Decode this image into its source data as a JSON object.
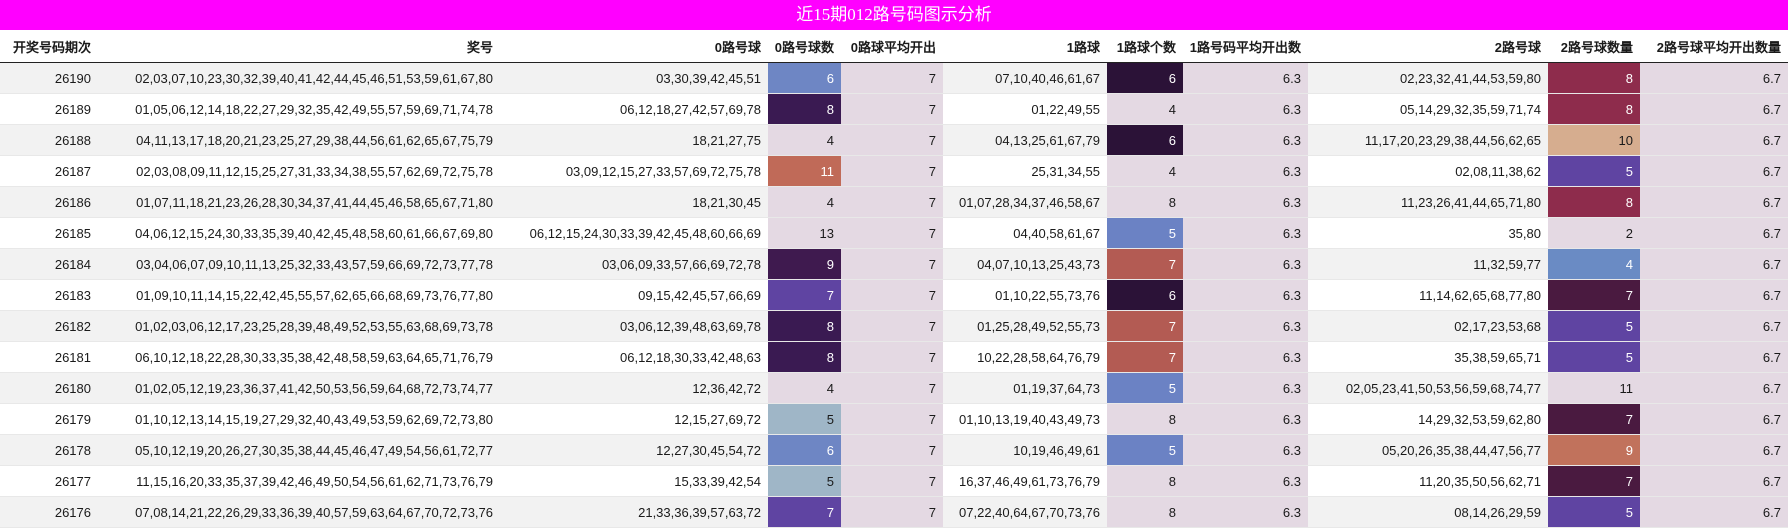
{
  "title": "近15期012路号码图示分析",
  "headers": [
    "开奖号码期次",
    "奖号",
    "0路号球",
    "0路号球数",
    "0路球平均开出",
    "1路球",
    "1路球个数",
    "1路号码平均开出数",
    "2路号球",
    "2路号球数量",
    "2路号球平均开出数量"
  ],
  "rows": [
    {
      "period": "26190",
      "numbers": "02,03,07,10,23,30,32,39,40,41,42,44,45,46,51,53,59,61,67,80",
      "r0": "03,30,39,42,45,51",
      "c0": "6",
      "a0": "7",
      "r1": "07,10,40,46,61,67",
      "c1": "6",
      "a1": "6.3",
      "r2": "02,23,32,41,44,53,59,80",
      "c2": "8",
      "a2": "6.7"
    },
    {
      "period": "26189",
      "numbers": "01,05,06,12,14,18,22,27,29,32,35,42,49,55,57,59,69,71,74,78",
      "r0": "06,12,18,27,42,57,69,78",
      "c0": "8",
      "a0": "7",
      "r1": "01,22,49,55",
      "c1": "4",
      "a1": "6.3",
      "r2": "05,14,29,32,35,59,71,74",
      "c2": "8",
      "a2": "6.7"
    },
    {
      "period": "26188",
      "numbers": "04,11,13,17,18,20,21,23,25,27,29,38,44,56,61,62,65,67,75,79",
      "r0": "18,21,27,75",
      "c0": "4",
      "a0": "7",
      "r1": "04,13,25,61,67,79",
      "c1": "6",
      "a1": "6.3",
      "r2": "11,17,20,23,29,38,44,56,62,65",
      "c2": "10",
      "a2": "6.7"
    },
    {
      "period": "26187",
      "numbers": "02,03,08,09,11,12,15,25,27,31,33,34,38,55,57,62,69,72,75,78",
      "r0": "03,09,12,15,27,33,57,69,72,75,78",
      "c0": "11",
      "a0": "7",
      "r1": "25,31,34,55",
      "c1": "4",
      "a1": "6.3",
      "r2": "02,08,11,38,62",
      "c2": "5",
      "a2": "6.7"
    },
    {
      "period": "26186",
      "numbers": "01,07,11,18,21,23,26,28,30,34,37,41,44,45,46,58,65,67,71,80",
      "r0": "18,21,30,45",
      "c0": "4",
      "a0": "7",
      "r1": "01,07,28,34,37,46,58,67",
      "c1": "8",
      "a1": "6.3",
      "r2": "11,23,26,41,44,65,71,80",
      "c2": "8",
      "a2": "6.7"
    },
    {
      "period": "26185",
      "numbers": "04,06,12,15,24,30,33,35,39,40,42,45,48,58,60,61,66,67,69,80",
      "r0": "06,12,15,24,30,33,39,42,45,48,60,66,69",
      "c0": "13",
      "a0": "7",
      "r1": "04,40,58,61,67",
      "c1": "5",
      "a1": "6.3",
      "r2": "35,80",
      "c2": "2",
      "a2": "6.7"
    },
    {
      "period": "26184",
      "numbers": "03,04,06,07,09,10,11,13,25,32,33,43,57,59,66,69,72,73,77,78",
      "r0": "03,06,09,33,57,66,69,72,78",
      "c0": "9",
      "a0": "7",
      "r1": "04,07,10,13,25,43,73",
      "c1": "7",
      "a1": "6.3",
      "r2": "11,32,59,77",
      "c2": "4",
      "a2": "6.7"
    },
    {
      "period": "26183",
      "numbers": "01,09,10,11,14,15,22,42,45,55,57,62,65,66,68,69,73,76,77,80",
      "r0": "09,15,42,45,57,66,69",
      "c0": "7",
      "a0": "7",
      "r1": "01,10,22,55,73,76",
      "c1": "6",
      "a1": "6.3",
      "r2": "11,14,62,65,68,77,80",
      "c2": "7",
      "a2": "6.7"
    },
    {
      "period": "26182",
      "numbers": "01,02,03,06,12,17,23,25,28,39,48,49,52,53,55,63,68,69,73,78",
      "r0": "03,06,12,39,48,63,69,78",
      "c0": "8",
      "a0": "7",
      "r1": "01,25,28,49,52,55,73",
      "c1": "7",
      "a1": "6.3",
      "r2": "02,17,23,53,68",
      "c2": "5",
      "a2": "6.7"
    },
    {
      "period": "26181",
      "numbers": "06,10,12,18,22,28,30,33,35,38,42,48,58,59,63,64,65,71,76,79",
      "r0": "06,12,18,30,33,42,48,63",
      "c0": "8",
      "a0": "7",
      "r1": "10,22,28,58,64,76,79",
      "c1": "7",
      "a1": "6.3",
      "r2": "35,38,59,65,71",
      "c2": "5",
      "a2": "6.7"
    },
    {
      "period": "26180",
      "numbers": "01,02,05,12,19,23,36,37,41,42,50,53,56,59,64,68,72,73,74,77",
      "r0": "12,36,42,72",
      "c0": "4",
      "a0": "7",
      "r1": "01,19,37,64,73",
      "c1": "5",
      "a1": "6.3",
      "r2": "02,05,23,41,50,53,56,59,68,74,77",
      "c2": "11",
      "a2": "6.7"
    },
    {
      "period": "26179",
      "numbers": "01,10,12,13,14,15,19,27,29,32,40,43,49,53,59,62,69,72,73,80",
      "r0": "12,15,27,69,72",
      "c0": "5",
      "a0": "7",
      "r1": "01,10,13,19,40,43,49,73",
      "c1": "8",
      "a1": "6.3",
      "r2": "14,29,32,53,59,62,80",
      "c2": "7",
      "a2": "6.7"
    },
    {
      "period": "26178",
      "numbers": "05,10,12,19,20,26,27,30,35,38,44,45,46,47,49,54,56,61,72,77",
      "r0": "12,27,30,45,54,72",
      "c0": "6",
      "a0": "7",
      "r1": "10,19,46,49,61",
      "c1": "5",
      "a1": "6.3",
      "r2": "05,20,26,35,38,44,47,56,77",
      "c2": "9",
      "a2": "6.7"
    },
    {
      "period": "26177",
      "numbers": "11,15,16,20,33,35,37,39,42,46,49,50,54,56,61,62,71,73,76,79",
      "r0": "15,33,39,42,54",
      "c0": "5",
      "a0": "7",
      "r1": "16,37,46,49,61,73,76,79",
      "c1": "8",
      "a1": "6.3",
      "r2": "11,20,35,50,56,62,71",
      "c2": "7",
      "a2": "6.7"
    },
    {
      "period": "26176",
      "numbers": "07,08,14,21,22,26,29,33,36,39,40,57,59,63,64,67,70,72,73,76",
      "r0": "21,33,36,39,57,63,72",
      "c0": "7",
      "a0": "7",
      "r1": "07,22,40,64,67,70,73,76",
      "c1": "8",
      "a1": "6.3",
      "r2": "08,14,26,29,59",
      "c2": "5",
      "a2": "6.7"
    }
  ],
  "heat_colors": {
    "2": "#e4d9e3",
    "4": "#e4d9e3",
    "5": "#6a7fc2",
    "6": "#2d1438",
    "7": "#b85c55",
    "8": "#3f1a4f",
    "9": "#3f1a4f",
    "10": "#d6ad8f",
    "11": "#b96a5a",
    "13": "#e4d9e3"
  },
  "heat_overrides": {
    "c0": {
      "5": "#9fb6c7",
      "6": "#6e86c4",
      "7": "#5f44a2",
      "8": "#3a1a52",
      "11": "#c06a58"
    },
    "c1": {
      "6": "#2b1237",
      "7": "#b35b53",
      "5": "#6b82c4",
      "8": "#e4d9e3",
      "4": "#e4d9e3"
    },
    "c2": {
      "8": "#8e2c4c",
      "5": "#5f44a2",
      "4": "#6a8bc4",
      "7": "#4a1a40",
      "9": "#c1725c",
      "10": "#d6ad8f",
      "11": "#e4d9e3",
      "2": "#e4d9e3"
    }
  }
}
